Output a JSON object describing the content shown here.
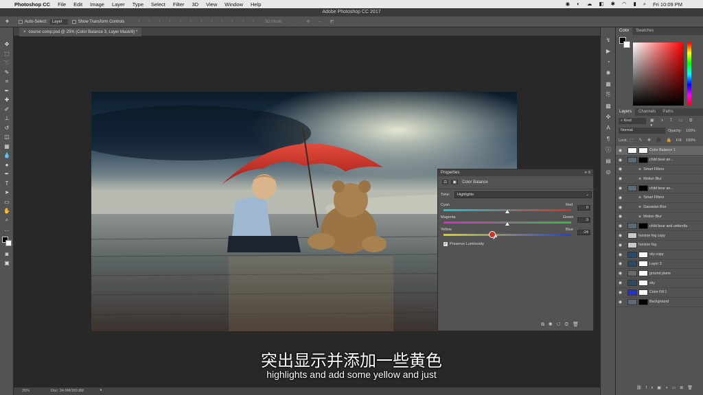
{
  "menubar": {
    "apple": "",
    "app": "Photoshop CC",
    "items": [
      "File",
      "Edit",
      "Image",
      "Layer",
      "Type",
      "Select",
      "Filter",
      "3D",
      "View",
      "Window",
      "Help"
    ],
    "clock": "Fri 10:09 PM"
  },
  "titlebar": {
    "title": "Adobe Photoshop CC 2017"
  },
  "optionsbar": {
    "auto_select": "Auto-Select:",
    "auto_select_value": "Layer",
    "show_transform": "Show Transform Controls",
    "mode_3d": "3D Mode:"
  },
  "document": {
    "tab_title": "course comp.psd @ 25% (Color Balance 3, Layer Mask/8) *"
  },
  "status": {
    "zoom": "25%",
    "doc": "Doc: 34.9M/369.8M"
  },
  "color_panel": {
    "tabs": [
      "Color",
      "Swatches"
    ]
  },
  "layers_panel": {
    "tabs": [
      "Layers",
      "Channels",
      "Paths"
    ],
    "kind": "Kind",
    "blend_mode": "Normal",
    "opacity_label": "Opacity:",
    "opacity": "100%",
    "lock_label": "Lock:",
    "fill_label": "Fill:",
    "fill": "100%",
    "layers": [
      {
        "name": "Color Balance 1",
        "indent": 0
      },
      {
        "name": "child bear an...",
        "indent": 0
      },
      {
        "name": "Smart Filters",
        "indent": 1
      },
      {
        "name": "Motion Blur",
        "indent": 1
      },
      {
        "name": "child bear an...",
        "indent": 0
      },
      {
        "name": "Smart Filters",
        "indent": 1
      },
      {
        "name": "Gaussian Blur",
        "indent": 1
      },
      {
        "name": "Motion Blur",
        "indent": 1
      },
      {
        "name": "child bear and umbrella",
        "indent": 0
      },
      {
        "name": "horizon fog copy",
        "indent": 0
      },
      {
        "name": "horizon fog",
        "indent": 0
      },
      {
        "name": "sky copy",
        "indent": 0
      },
      {
        "name": "Layer 3",
        "indent": 0
      },
      {
        "name": "ground plane",
        "indent": 0
      },
      {
        "name": "sky",
        "indent": 0
      },
      {
        "name": "Color Fill 1",
        "indent": 0
      },
      {
        "name": "Background",
        "indent": 0
      }
    ]
  },
  "properties": {
    "title": "Properties",
    "adjustment": "Color Balance",
    "tone_label": "Tone:",
    "tone_value": "Highlights",
    "sliders": [
      {
        "left": "Cyan",
        "right": "Red",
        "value": "0",
        "pos": 0.5
      },
      {
        "left": "Magenta",
        "right": "Green",
        "value": "0",
        "pos": 0.5
      },
      {
        "left": "Yellow",
        "right": "Blue",
        "value": "-24",
        "pos": 0.38
      }
    ],
    "preserve": "Preserve Luminosity"
  },
  "subtitles": {
    "zh": "突出显示并添加一些黄色",
    "en": "highlights and add some yellow and just"
  }
}
